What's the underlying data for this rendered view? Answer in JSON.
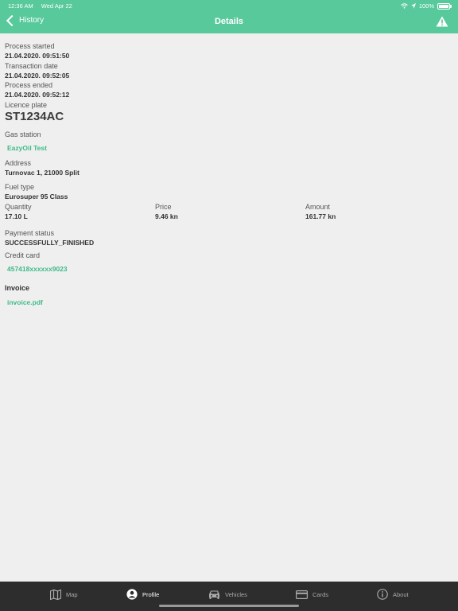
{
  "status": {
    "time": "12:36 AM",
    "date": "Wed Apr 22",
    "battery": "100%"
  },
  "nav": {
    "back_label": "History",
    "title": "Details"
  },
  "details": {
    "process_started_label": "Process started",
    "process_started_value": "21.04.2020. 09:51:50",
    "transaction_date_label": "Transaction date",
    "transaction_date_value": "21.04.2020. 09:52:05",
    "process_ended_label": "Process ended",
    "process_ended_value": "21.04.2020. 09:52:12",
    "licence_plate_label": "Licence plate",
    "licence_plate_value": "ST1234AC",
    "gas_station_label": "Gas station",
    "gas_station_value": "EazyOil Test",
    "address_label": "Address",
    "address_value": "Turnovac 1, 21000 Split",
    "fuel_type_label": "Fuel type",
    "fuel_type_value": "Eurosuper 95 Class",
    "quantity_label": "Quantity",
    "quantity_value": "17.10 L",
    "price_label": "Price",
    "price_value": "9.46 kn",
    "amount_label": "Amount",
    "amount_value": "161.77 kn",
    "payment_status_label": "Payment status",
    "payment_status_value": "SUCCESSFULLY_FINISHED",
    "credit_card_label": "Credit card",
    "credit_card_value": "457418xxxxxx9023",
    "invoice_label": "Invoice",
    "invoice_value": "invoice.pdf"
  },
  "tabs": [
    {
      "label": "Map",
      "icon": "map-icon"
    },
    {
      "label": "Profile",
      "icon": "profile-icon"
    },
    {
      "label": "Vehicles",
      "icon": "car-icon"
    },
    {
      "label": "Cards",
      "icon": "card-icon"
    },
    {
      "label": "About",
      "icon": "info-icon"
    }
  ],
  "colors": {
    "header": "#57c99b",
    "link": "#3dbb88",
    "tabbar": "#2d2d2d"
  }
}
